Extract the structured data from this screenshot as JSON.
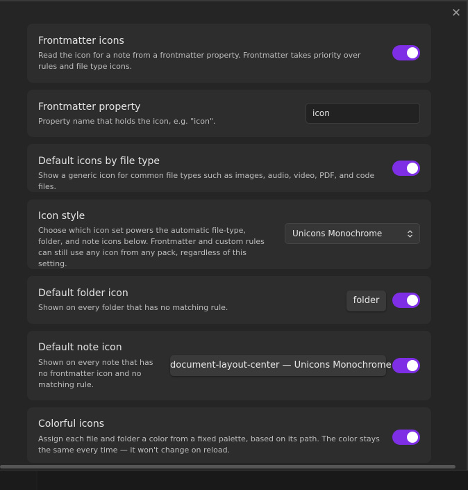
{
  "modal": {
    "close_glyph": "✕"
  },
  "settings": [
    {
      "title": "Frontmatter icons",
      "desc": "Read the icon for a note from a frontmatter property. Frontmatter takes priority over rules and file type icons.",
      "toggle_on": true
    },
    {
      "title": "Frontmatter property",
      "desc": "Property name that holds the icon, e.g. \"icon\".",
      "input_value": "icon"
    },
    {
      "title": "Default icons by file type",
      "desc": "Show a generic icon for common file types such as images, audio, video, PDF, and code files.",
      "toggle_on": true
    },
    {
      "title": "Icon style",
      "desc": "Choose which icon set powers the automatic file-type, folder, and note icons below. Frontmatter and custom rules can still use any icon from any pack, regardless of this setting.",
      "select_value": "Unicons Monochrome"
    },
    {
      "title": "Default folder icon",
      "desc": "Shown on every folder that has no matching rule.",
      "button_label": "folder",
      "toggle_on": true
    },
    {
      "title": "Default note icon",
      "desc": "Shown on every note that has no frontmatter icon and no matching rule.",
      "button_label": "document-layout-center — Unicons Monochrome",
      "toggle_on": true
    },
    {
      "title": "Colorful icons",
      "desc": "Assign each file and folder a color from a fixed palette, based on its path. The color stays the same every time — it won't change on reload.",
      "toggle_on": true
    }
  ],
  "colors": {
    "accent": "#7e2fe6",
    "card": "#2d2d2d",
    "background": "#252525"
  },
  "icons": {
    "close": "close-icon",
    "select": "chevron-up-down-icon"
  }
}
